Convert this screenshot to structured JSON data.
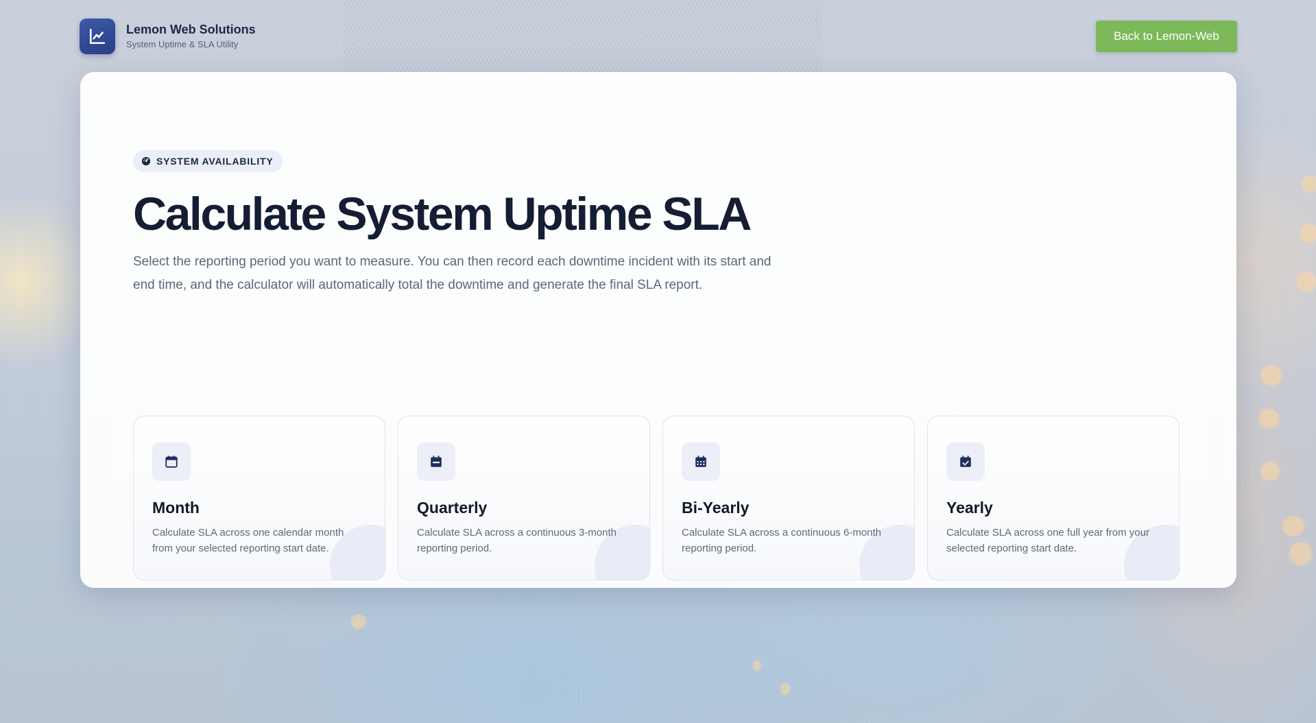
{
  "brand": {
    "name": "Lemon Web Solutions",
    "subtitle": "System Uptime & SLA Utility",
    "logo_icon": "line-chart-icon"
  },
  "header": {
    "back_button_label": "Back to Lemon-Web"
  },
  "hero": {
    "badge_label": "SYSTEM AVAILABILITY",
    "badge_icon": "gauge-icon",
    "title": "Calculate System Uptime SLA",
    "description": "Select the reporting period you want to measure. You can then record each downtime incident with its start and end time, and the calculator will automatically total the downtime and generate the final SLA report."
  },
  "options": [
    {
      "title": "Month",
      "description": "Calculate SLA across one calendar month from your selected reporting start date.",
      "icon": "calendar-icon"
    },
    {
      "title": "Quarterly",
      "description": "Calculate SLA across a continuous 3-month reporting period.",
      "icon": "calendar-bar-icon"
    },
    {
      "title": "Bi-Yearly",
      "description": "Calculate SLA across a continuous 6-month reporting period.",
      "icon": "calendar-grid-icon"
    },
    {
      "title": "Yearly",
      "description": "Calculate SLA across one full year from your selected reporting start date.",
      "icon": "calendar-check-icon"
    }
  ],
  "colors": {
    "primary_navy": "#1c2741",
    "accent_green": "#7db859",
    "logo_blue": "#2f4a96"
  }
}
